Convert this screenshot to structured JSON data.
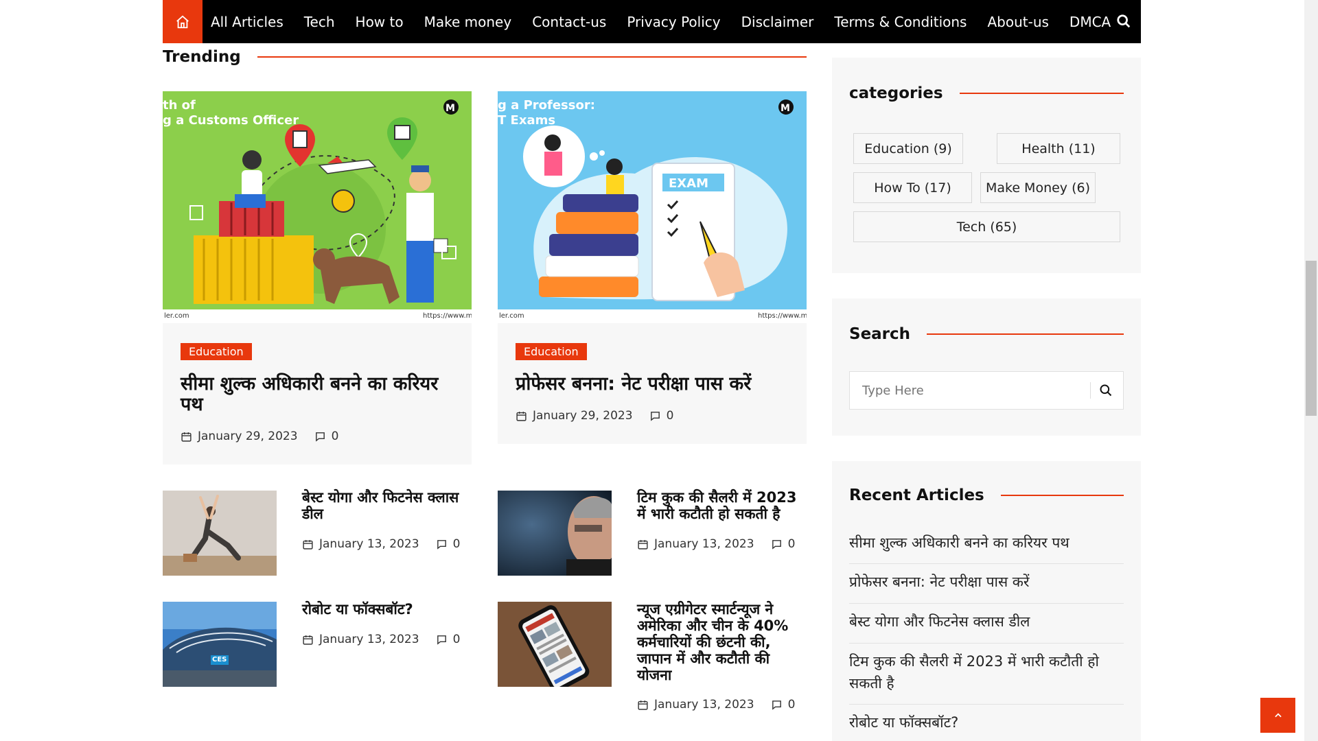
{
  "nav": {
    "items": [
      "All Articles",
      "Tech",
      "How to",
      "Make money",
      "Contact-us",
      "Privacy Policy",
      "Disclaimer",
      "Terms & Conditions",
      "About-us",
      "DMCA"
    ]
  },
  "colors": {
    "accent": "#e8380d",
    "nav_bg": "#000000",
    "card_bg": "#f7f7f7"
  },
  "trending": {
    "title": "Trending",
    "cards": [
      {
        "badge": "Education",
        "title": "सीमा शुल्क अधिकारी बनने का करियर पथ",
        "date": "January 29, 2023",
        "comments": "0",
        "img_text_line1": "th of",
        "img_text_line2": "g a Customs Officer",
        "img_footer_left": "ler.com",
        "img_footer_right": "https://www.m"
      },
      {
        "badge": "Education",
        "title": "प्रोफेसर बनना: नेट परीक्षा पास करें",
        "date": "January 29, 2023",
        "comments": "0",
        "img_text_line1": "g a Professor:",
        "img_text_line2": "T Exams",
        "img_exam": "EXAM",
        "img_footer_left": "ler.com",
        "img_footer_right": "https://www.m"
      }
    ],
    "small_posts": [
      {
        "title": "बेस्ट योगा और फिटनेस क्लास डील",
        "date": "January 13, 2023",
        "comments": "0"
      },
      {
        "title": "टिम कुक की सैलरी में 2023 में भारी कटौती हो सकती है",
        "date": "January 13, 2023",
        "comments": "0"
      },
      {
        "title": "रोबोट या फॉक्सबॉट?",
        "date": "January 13, 2023",
        "comments": "0",
        "img_text": "CES"
      },
      {
        "title": "न्यूज एग्रीगेटर स्मार्टन्यूज ने अमेरिका और चीन के 40% कर्मचारियों की छंटनी की, जापान में और कटौती की योजना",
        "date": "January 13, 2023",
        "comments": "0"
      }
    ]
  },
  "sidebar": {
    "categories": {
      "title": "categories",
      "items": [
        "Education (9)",
        "Health (11)",
        "How To (17)",
        "Make Money (6)",
        "Tech (65)"
      ]
    },
    "search": {
      "title": "Search",
      "placeholder": "Type Here"
    },
    "recent": {
      "title": "Recent Articles",
      "items": [
        "सीमा शुल्क अधिकारी बनने का करियर पथ",
        "प्रोफेसर बनना: नेट परीक्षा पास करें",
        "बेस्ट योगा और फिटनेस क्लास डील",
        "टिम कुक की सैलरी में 2023 में भारी कटौती हो सकती है",
        "रोबोट या फॉक्सबॉट?"
      ]
    }
  }
}
